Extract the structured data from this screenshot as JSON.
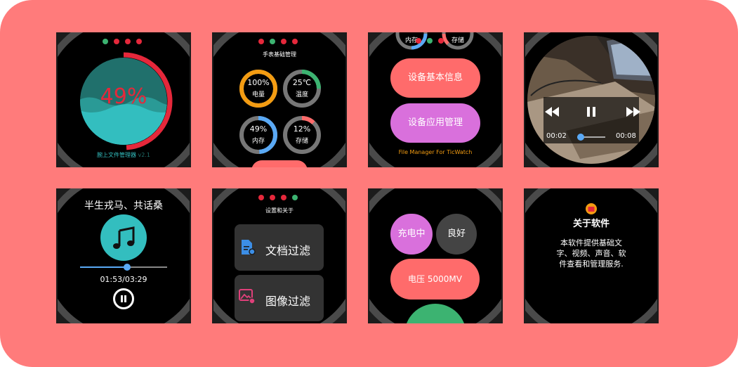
{
  "colors": {
    "background": "#FF7B7B",
    "tile": "#1c1c1c",
    "bezel": "#4a4a4a",
    "red": "#E5283B",
    "teal": "#33BEBF",
    "green": "#3CB371",
    "orange": "#F39C12",
    "blue": "#5AA9F5",
    "salmon": "#FF6B6B",
    "purple": "#D970DC"
  },
  "screen1": {
    "percent": "49%",
    "fill_level": 0.49,
    "footer_prefix": "腕上文件管理器",
    "footer_version": "v2.1",
    "dots": [
      "#3CB371",
      "#E5283B",
      "#E5283B",
      "#E5283B"
    ]
  },
  "screen2": {
    "title": "手表基础管理",
    "gauges": [
      {
        "value": "100%",
        "label": "电量",
        "level": 1.0,
        "color": "#F39C12"
      },
      {
        "value": "25℃",
        "label": "温度",
        "level": 0.25,
        "color": "#3CB371"
      },
      {
        "value": "49%",
        "label": "内存",
        "level": 0.49,
        "color": "#5AA9F5"
      },
      {
        "value": "12%",
        "label": "存储",
        "level": 0.12,
        "color": "#FF6B6B"
      }
    ],
    "dots": [
      "#E5283B",
      "#3CB371",
      "#E5283B",
      "#E5283B"
    ]
  },
  "screen3": {
    "top_labels": [
      "内存",
      "存储"
    ],
    "button_info": "设备基本信息",
    "button_apps": "设备应用管理",
    "footer": "File Manager For TicWatch"
  },
  "screen4": {
    "time_current": "00:02",
    "time_total": "00:08",
    "progress": 0.12,
    "icons": [
      "rewind-icon",
      "pause-icon",
      "fast-forward-icon"
    ]
  },
  "screen5": {
    "title": "半生戎马、共话桑",
    "time": "01:53/03:29",
    "progress": 0.54,
    "icons": [
      "music-note-icon",
      "pause-icon"
    ]
  },
  "screen6": {
    "title": "设置和关于",
    "items": [
      {
        "label": "文档过滤",
        "icon": "document-settings-icon"
      },
      {
        "label": "图像过滤",
        "icon": "image-settings-icon"
      }
    ],
    "dots": [
      "#E5283B",
      "#E5283B",
      "#E5283B",
      "#3CB371"
    ]
  },
  "screen7": {
    "charging": "充电中",
    "health": "良好",
    "voltage": "电压 5000MV"
  },
  "screen8": {
    "title": "关于软件",
    "body_lines": [
      "本软件提供基础文",
      "字、视频、声音、软",
      "件查看和管理服务."
    ],
    "icons": [
      "app-logo-icon"
    ]
  }
}
